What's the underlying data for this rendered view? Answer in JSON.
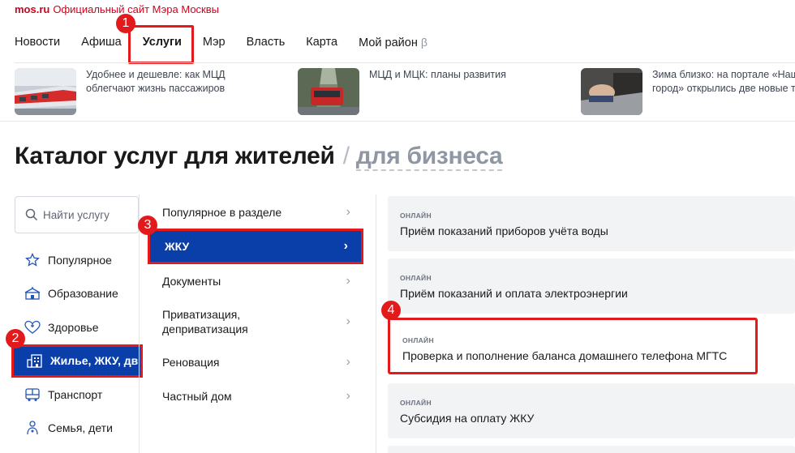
{
  "brand": {
    "logo": "mos.ru",
    "tagline": "Официальный сайт Мэра Москвы"
  },
  "nav": {
    "items": [
      "Новости",
      "Афиша",
      "Услуги",
      "Мэр",
      "Власть",
      "Карта",
      "Мой район"
    ],
    "beta": "β",
    "active": "Услуги"
  },
  "news": [
    {
      "text1": "Удобнее и дешевле: как МЦД",
      "text2": "облегчают жизнь пассажиров"
    },
    {
      "text1": "МЦД и МЦК: планы развития",
      "text2": ""
    },
    {
      "text1": "Зима близко: на портале «Наш",
      "text2": "город» открылись две новые т"
    }
  ],
  "title": {
    "main": "Каталог услуг для жителей",
    "sep": "/",
    "alt": "для бизнеса"
  },
  "search": {
    "placeholder": "Найти услугу"
  },
  "categories": [
    {
      "label": "Популярное",
      "icon": "star-icon"
    },
    {
      "label": "Образование",
      "icon": "education-icon"
    },
    {
      "label": "Здоровье",
      "icon": "health-icon"
    },
    {
      "label": "Жилье, ЖКУ, дв",
      "icon": "house-icon"
    },
    {
      "label": "Транспорт",
      "icon": "bus-icon"
    },
    {
      "label": "Семья, дети",
      "icon": "family-icon"
    }
  ],
  "subcategories": [
    {
      "label": "Популярное в разделе"
    },
    {
      "label": "ЖКУ"
    },
    {
      "label": "Документы"
    },
    {
      "label": "Приватизация, деприватизация"
    },
    {
      "label": "Реновация"
    },
    {
      "label": "Частный дом"
    }
  ],
  "services": [
    {
      "tag": "ОНЛАЙН",
      "name": "Приём показаний приборов учёта воды"
    },
    {
      "tag": "ОНЛАЙН",
      "name": "Приём показаний и оплата электроэнергии"
    },
    {
      "tag": "ОНЛАЙН",
      "name": "Проверка и пополнение баланса домашнего телефона МГТС"
    },
    {
      "tag": "ОНЛАЙН",
      "name": "Субсидия на оплату ЖКУ"
    }
  ],
  "badges": [
    "1",
    "2",
    "3",
    "4"
  ],
  "colors": {
    "brand_red": "#d0021b",
    "active_blue": "#0a3ea8",
    "highlight_red": "#e31a1c"
  }
}
